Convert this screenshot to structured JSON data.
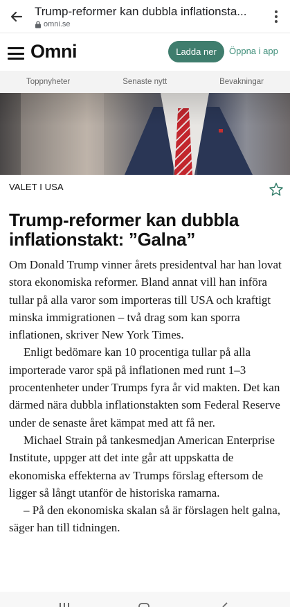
{
  "browser": {
    "tab_title": "Trump-reformer kan dubbla inflationsta...",
    "url": "omni.se",
    "icons": [
      "arrow-left-icon",
      "lock-icon",
      "more-vert-icon"
    ]
  },
  "header": {
    "logo": "Omni",
    "download_label": "Ladda ner",
    "open_app_label": "Öppna i app",
    "accent_color": "#3f7d6d"
  },
  "nav": {
    "tabs": [
      {
        "label": "Toppnyheter"
      },
      {
        "label": "Senaste nytt"
      },
      {
        "label": "Bevakningar"
      }
    ]
  },
  "article": {
    "category": "VALET I USA",
    "headline": "Trump-reformer kan dubbla inflationstakt: ”Galna”",
    "paragraphs": [
      "Om Donald Trump vinner årets presidentval har han lovat stora ekonomiska reformer. Bland annat vill han införa tullar på alla varor som importeras till USA och kraftigt minska immigrationen – två drag som kan sporra inflationen, skriver New York Times.",
      "Enligt bedömare kan 10 procentiga tullar på alla importerade varor spä på inflationen med runt 1–3 procentenheter under Trumps fyra år vid makten. Det kan därmed nära dubbla inflationstakten som Federal Reserve under de senaste året kämpat med att få ner.",
      "Michael Strain på tankesmedjan American Enterprise Institute, uppger att det inte går att uppskatta de ekonomiska effekterna av Trumps förslag eftersom de ligger så långt utanför de historiska ramarna.",
      "– På den ekonomiska skalan så är förslagen helt galna, säger han till tidningen."
    ]
  }
}
